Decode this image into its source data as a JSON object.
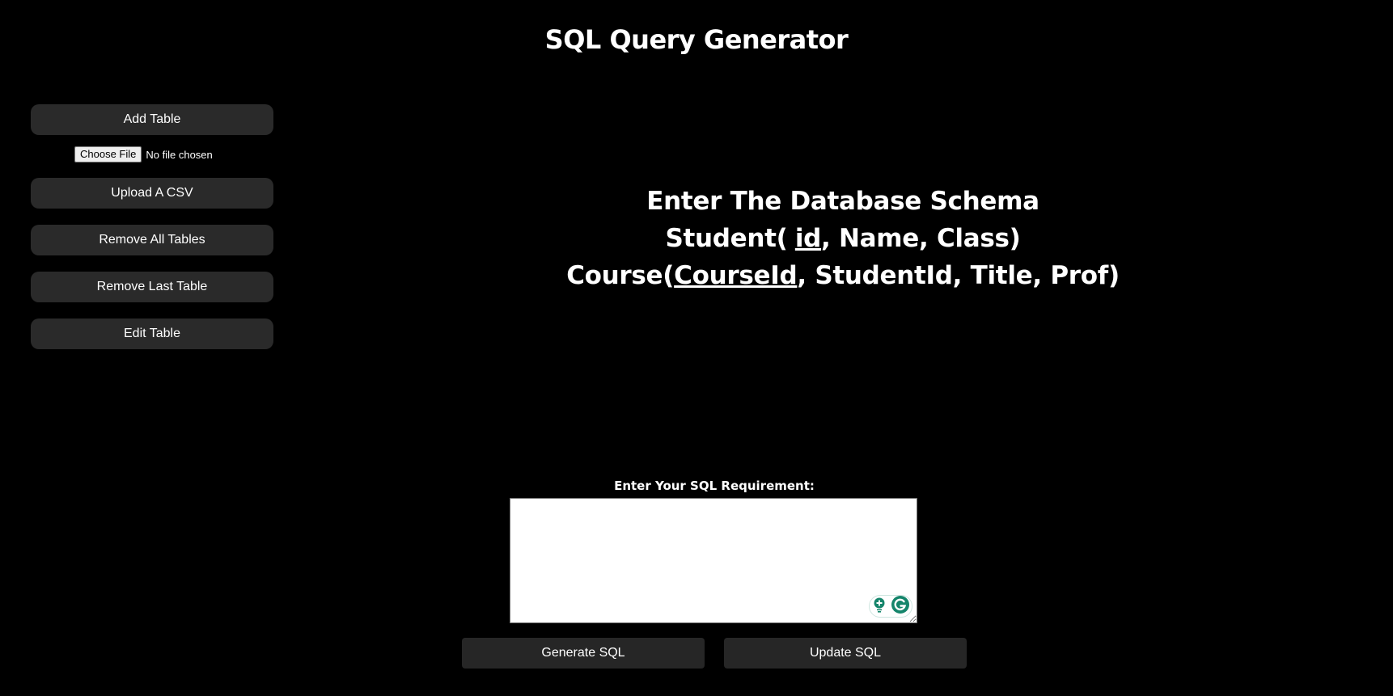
{
  "header": {
    "title": "SQL Query Generator"
  },
  "sidebar": {
    "add_table": "Add Table",
    "file_input": {
      "button_label": "Choose File",
      "status": "No file chosen"
    },
    "upload_csv": "Upload A CSV",
    "remove_all": "Remove All Tables",
    "remove_last": "Remove Last Table",
    "edit_table": "Edit Table"
  },
  "schema": {
    "heading": "Enter The Database Schema",
    "tables": [
      {
        "name": "Student(",
        "key": "id",
        "rest": ", Name, Class)"
      },
      {
        "name": "Course(",
        "key": "CourseId",
        "rest": ", StudentId, Title, Prof)"
      }
    ]
  },
  "requirement": {
    "label": "Enter Your SQL Requirement:",
    "value": ""
  },
  "actions": {
    "generate": "Generate SQL",
    "update": "Update SQL"
  },
  "colors": {
    "background": "#000000",
    "button_bg": "#2a2a2a",
    "text": "#ffffff",
    "grammarly_green": "#15856b"
  },
  "icons": {
    "grammarly_suggest": "lightbulb-icon",
    "grammarly_logo": "grammarly-icon"
  }
}
